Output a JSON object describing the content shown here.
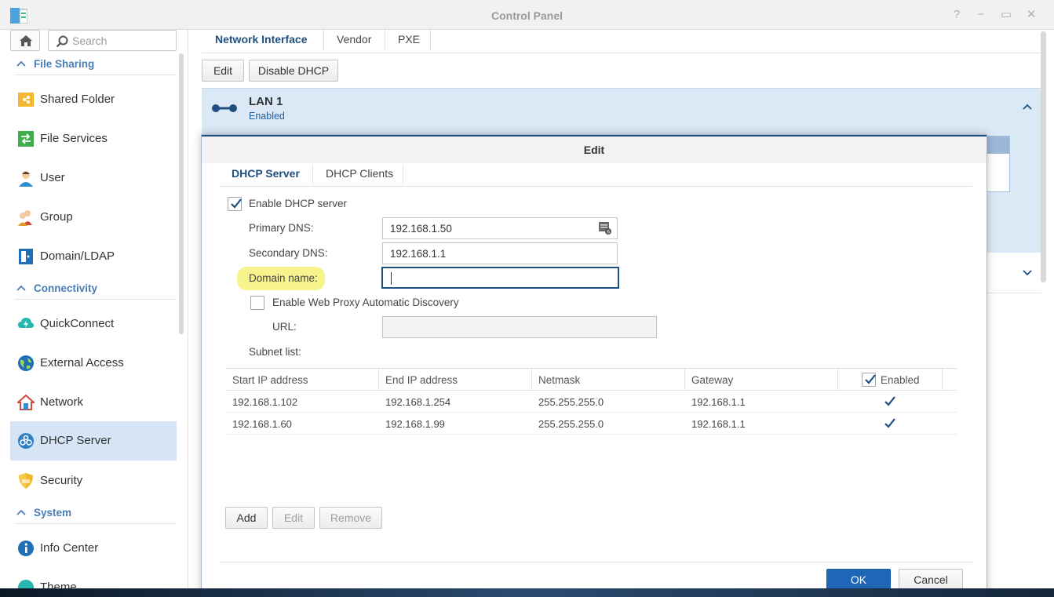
{
  "window": {
    "title": "Control Panel"
  },
  "sidebar": {
    "search_placeholder": "Search",
    "sections": [
      {
        "label": "File Sharing"
      },
      {
        "label": "Connectivity"
      },
      {
        "label": "System"
      }
    ],
    "items": [
      {
        "label": "Shared Folder"
      },
      {
        "label": "File Services"
      },
      {
        "label": "User"
      },
      {
        "label": "Group"
      },
      {
        "label": "Domain/LDAP"
      },
      {
        "label": "QuickConnect"
      },
      {
        "label": "External Access"
      },
      {
        "label": "Network"
      },
      {
        "label": "DHCP Server",
        "selected": true
      },
      {
        "label": "Security"
      },
      {
        "label": "Info Center"
      },
      {
        "label": "Theme"
      }
    ]
  },
  "main": {
    "tabs": [
      {
        "label": "Network Interface",
        "active": true
      },
      {
        "label": "Vendor"
      },
      {
        "label": "PXE"
      }
    ],
    "toolbar": {
      "edit_label": "Edit",
      "disable_dhcp_label": "Disable DHCP"
    },
    "lan": {
      "name": "LAN 1",
      "status": "Enabled"
    }
  },
  "dialog": {
    "title": "Edit",
    "tabs": [
      {
        "label": "DHCP Server",
        "active": true
      },
      {
        "label": "DHCP Clients"
      }
    ],
    "enable_dhcp": {
      "label": "Enable DHCP server",
      "checked": true
    },
    "primary_dns": {
      "label": "Primary DNS:",
      "value": "192.168.1.50"
    },
    "secondary_dns": {
      "label": "Secondary DNS:",
      "value": "192.168.1.1"
    },
    "domain_name": {
      "label": "Domain name:",
      "value": ""
    },
    "wpad": {
      "label": "Enable Web Proxy Automatic Discovery",
      "checked": false
    },
    "url": {
      "label": "URL:",
      "value": ""
    },
    "subnet_list_label": "Subnet list:",
    "table": {
      "headers": [
        "Start IP address",
        "End IP address",
        "Netmask",
        "Gateway",
        "Enabled"
      ],
      "rows": [
        {
          "start": "192.168.1.102",
          "end": "192.168.1.254",
          "netmask": "255.255.255.0",
          "gateway": "192.168.1.1",
          "enabled": true
        },
        {
          "start": "192.168.1.60",
          "end": "192.168.1.99",
          "netmask": "255.255.255.0",
          "gateway": "192.168.1.1",
          "enabled": true
        }
      ]
    },
    "buttons": {
      "add": "Add",
      "edit": "Edit",
      "remove": "Remove",
      "ok": "OK",
      "cancel": "Cancel"
    }
  },
  "colors": {
    "accent": "#1f4f80",
    "selected_bg": "#d5e5f5",
    "primary_button": "#1f66b7",
    "highlight": "#f6f27a"
  }
}
